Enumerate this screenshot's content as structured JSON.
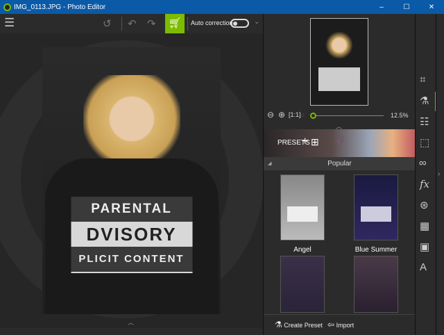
{
  "window": {
    "title": "IMG_0113.JPG - Photo Editor",
    "minimize": "–",
    "maximize": "☐",
    "close": "✕"
  },
  "toolbar": {
    "auto_correction": "Auto correction",
    "dropdown": "⌄"
  },
  "photo": {
    "shirt_lines": [
      "PARENTAL",
      "DVISORY",
      "PLICIT CONTENT"
    ]
  },
  "zoom": {
    "level": "12.5%",
    "fit_label": "[1:1]",
    "value": 0.0
  },
  "presets": {
    "label": "PRESETS",
    "add": "+",
    "grid": "⊞",
    "section": "Popular",
    "items": [
      {
        "name": "Angel"
      },
      {
        "name": "Blue Summer"
      },
      {
        "name": ""
      },
      {
        "name": ""
      }
    ]
  },
  "bottom": {
    "create_preset": "Create Preset",
    "import": "Import"
  },
  "colors": {
    "accent": "#7cbb00",
    "titlebar": "#0a5aa8"
  }
}
